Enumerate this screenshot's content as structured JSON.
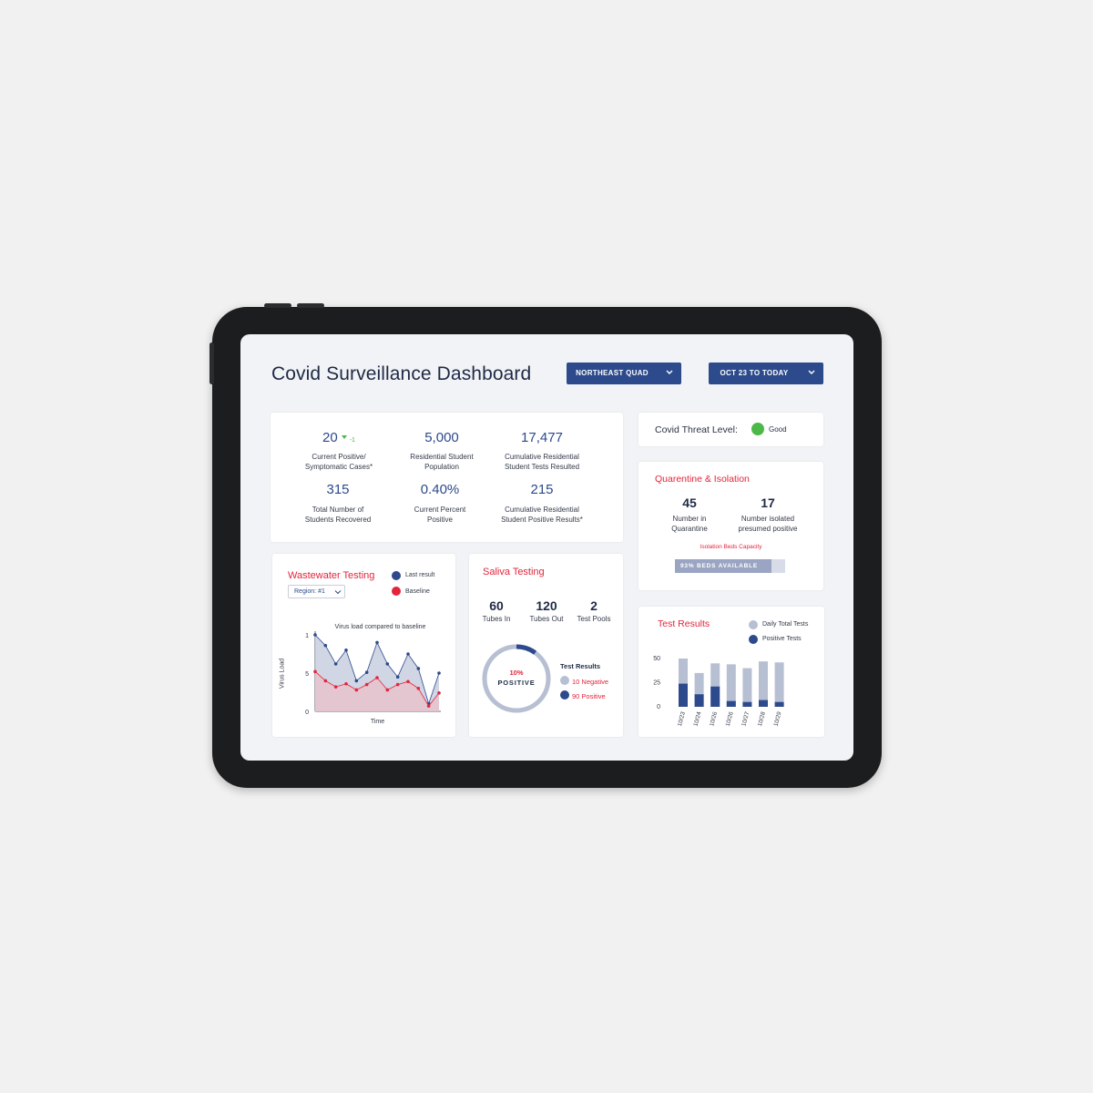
{
  "dashboard": {
    "title": "Covid Surveillance Dashboard",
    "region_filter": "NORTHEAST QUAD",
    "date_filter": "OCT 23 TO TODAY"
  },
  "stats": [
    {
      "value": "20",
      "label_line1": "Current Positive/",
      "label_line2": "Symptomatic Cases*"
    },
    {
      "value": "5,000",
      "label_line1": "Residential Student",
      "label_line2": "Population"
    },
    {
      "value": "17,477",
      "label_line1": "Cumulative Residential",
      "label_line2": "Student Tests Resulted"
    },
    {
      "value": "315",
      "label_line1": "Total Number of",
      "label_line2": "Students Recovered"
    },
    {
      "value": "0.40%",
      "label_line1": "Current Percent",
      "label_line2": "Positive"
    },
    {
      "value": "215",
      "label_line1": "Cumulative Residential",
      "label_line2": "Student Positive Results*"
    }
  ],
  "stat_delta": "-1",
  "threat": {
    "label": "Covid Threat Level:",
    "status": "Good",
    "color": "#4cb848"
  },
  "quarantine": {
    "title": "Quarentine & Isolation",
    "in_quarantine": "45",
    "in_quarantine_label1": "Number in",
    "in_quarantine_label2": "Quarantine",
    "isolated": "17",
    "isolated_label1": "Number isolated",
    "isolated_label2": "presumed positive",
    "capacity_label": "Isolation Beds Capacity",
    "beds_available": "93% BEDS AVAILABLE",
    "beds_fraction": 0.88
  },
  "wastewater": {
    "title": "Wastewater Testing",
    "region_select": "Region: #1",
    "legend_last": "Last result",
    "legend_baseline": "Baseline",
    "chart_title": "Virus load compared to baseline",
    "y_label": "Virus Load",
    "x_label": "Time"
  },
  "saliva": {
    "title": "Saliva Testing",
    "tubes_in": "60",
    "tubes_in_label": "Tubes In",
    "tubes_out": "120",
    "tubes_out_label": "Tubes Out",
    "test_pools": "2",
    "test_pools_label": "Test Pools",
    "percent": "10%",
    "percent_label": "POSITIVE",
    "results_title": "Test Results",
    "negative": "10 Negative",
    "positive": "90 Positive"
  },
  "test_results": {
    "title": "Test Results",
    "legend_total": "Daily Total Tests",
    "legend_positive": "Positive Tests"
  },
  "colors": {
    "navy": "#2c4a8c",
    "red": "#e4243b",
    "light": "#b7bfd3",
    "pink_fill": "#e8c3cc",
    "blue_fill": "#c9cfe1"
  },
  "chart_data": [
    {
      "type": "area",
      "title": "Virus load compared to baseline",
      "xlabel": "Time",
      "ylabel": "Virus Load",
      "ylim": [
        0,
        10
      ],
      "yticks": [
        "1",
        "5",
        "0"
      ],
      "series": [
        {
          "name": "Last result",
          "values": [
            10,
            8.6,
            6.2,
            8.0,
            4.0,
            5.1,
            9.0,
            6.2,
            4.5,
            7.5,
            5.6,
            1.0,
            5.0
          ]
        },
        {
          "name": "Baseline",
          "values": [
            5.2,
            4.0,
            3.2,
            3.6,
            2.8,
            3.5,
            4.4,
            2.8,
            3.5,
            3.9,
            3.0,
            0.7,
            2.4
          ]
        }
      ]
    },
    {
      "type": "pie",
      "values": [
        10,
        90
      ],
      "labels": [
        "10 Negative",
        "90 Positive"
      ]
    },
    {
      "type": "bar",
      "categories": [
        "10/23",
        "10/24",
        "10/26",
        "10/26",
        "10/27",
        "10/28",
        "10/29"
      ],
      "ylim": [
        0,
        50
      ],
      "yticks": [
        "50",
        "25",
        "0"
      ],
      "series": [
        {
          "name": "Daily Total Tests",
          "values": [
            50,
            35,
            45,
            44,
            40,
            47,
            46
          ]
        },
        {
          "name": "Positive Tests",
          "values": [
            24,
            13,
            21,
            6,
            5,
            7,
            5
          ]
        }
      ]
    }
  ]
}
